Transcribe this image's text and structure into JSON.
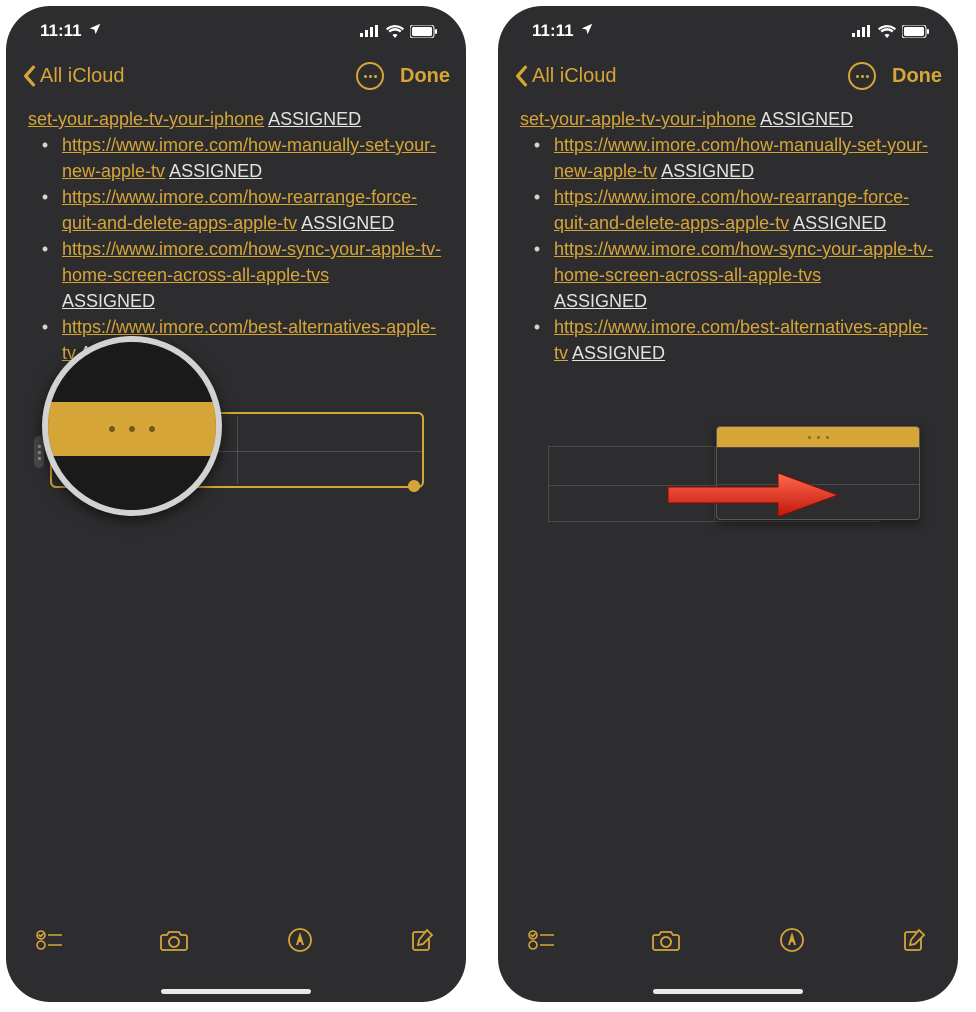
{
  "status": {
    "time": "11:11"
  },
  "nav": {
    "back_label": "All iCloud",
    "done_label": "Done"
  },
  "note": {
    "line1_link": "set-your-apple-tv-your-iphone",
    "assigned": "ASSIGNED",
    "line2_link": "https://www.imore.com/how-manually-set-your-new-apple-tv",
    "line3_link": "https://www.imore.com/how-rearrange-force-quit-and-delete-apps-apple-tv",
    "line4_link": "https://www.imore.com/how-sync-your-apple-tv-home-screen-across-all-apple-tvs",
    "line5_link": "https://www.imore.com/best-alternatives-apple-tv",
    "bullet": "•"
  }
}
